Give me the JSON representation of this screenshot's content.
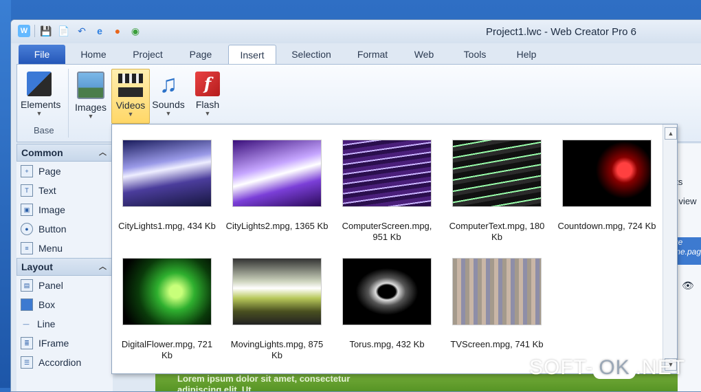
{
  "window": {
    "title": "Project1.lwc - Web Creator Pro 6"
  },
  "ribbon_tabs": [
    "File",
    "Home",
    "Project",
    "Page",
    "Insert",
    "Selection",
    "Format",
    "Web",
    "Tools",
    "Help"
  ],
  "ribbon": {
    "elements": "Elements",
    "images": "Images",
    "videos": "Videos",
    "sounds": "Sounds",
    "flash": "Flash",
    "group_base": "Base",
    "flash_glyph": "f"
  },
  "sidebar": {
    "common": {
      "title": "Common",
      "items": [
        "Page",
        "Text",
        "Image",
        "Button",
        "Menu"
      ]
    },
    "layout": {
      "title": "Layout",
      "items": [
        "Panel",
        "Box",
        "Line",
        "IFrame",
        "Accordion"
      ]
    }
  },
  "gallery": [
    {
      "caption": "CityLights1.mpg, 434 Kb"
    },
    {
      "caption": "CityLights2.mpg, 1365 Kb"
    },
    {
      "caption": "ComputerScreen.mpg, 951 Kb"
    },
    {
      "caption": "ComputerText.mpg, 180 Kb"
    },
    {
      "caption": "Countdown.mpg, 724 Kb"
    },
    {
      "caption": "DigitalFlower.mpg, 721 Kb"
    },
    {
      "caption": "MovingLights.mpg, 875 Kb"
    },
    {
      "caption": "Torus.mpg, 432 Kb"
    },
    {
      "caption": "TVScreen.mpg, 741 Kb"
    }
  ],
  "background": {
    "partial1": "nts",
    "partial2": "l view",
    "partial3": "ge",
    "partial4": "me.pag",
    "lorem": "Lorem ipsum dolor sit amet, consectetur adipiscing elit. Ut"
  },
  "watermark": {
    "left": "SOFT-",
    "ok": "OK",
    "right": ".NET"
  }
}
